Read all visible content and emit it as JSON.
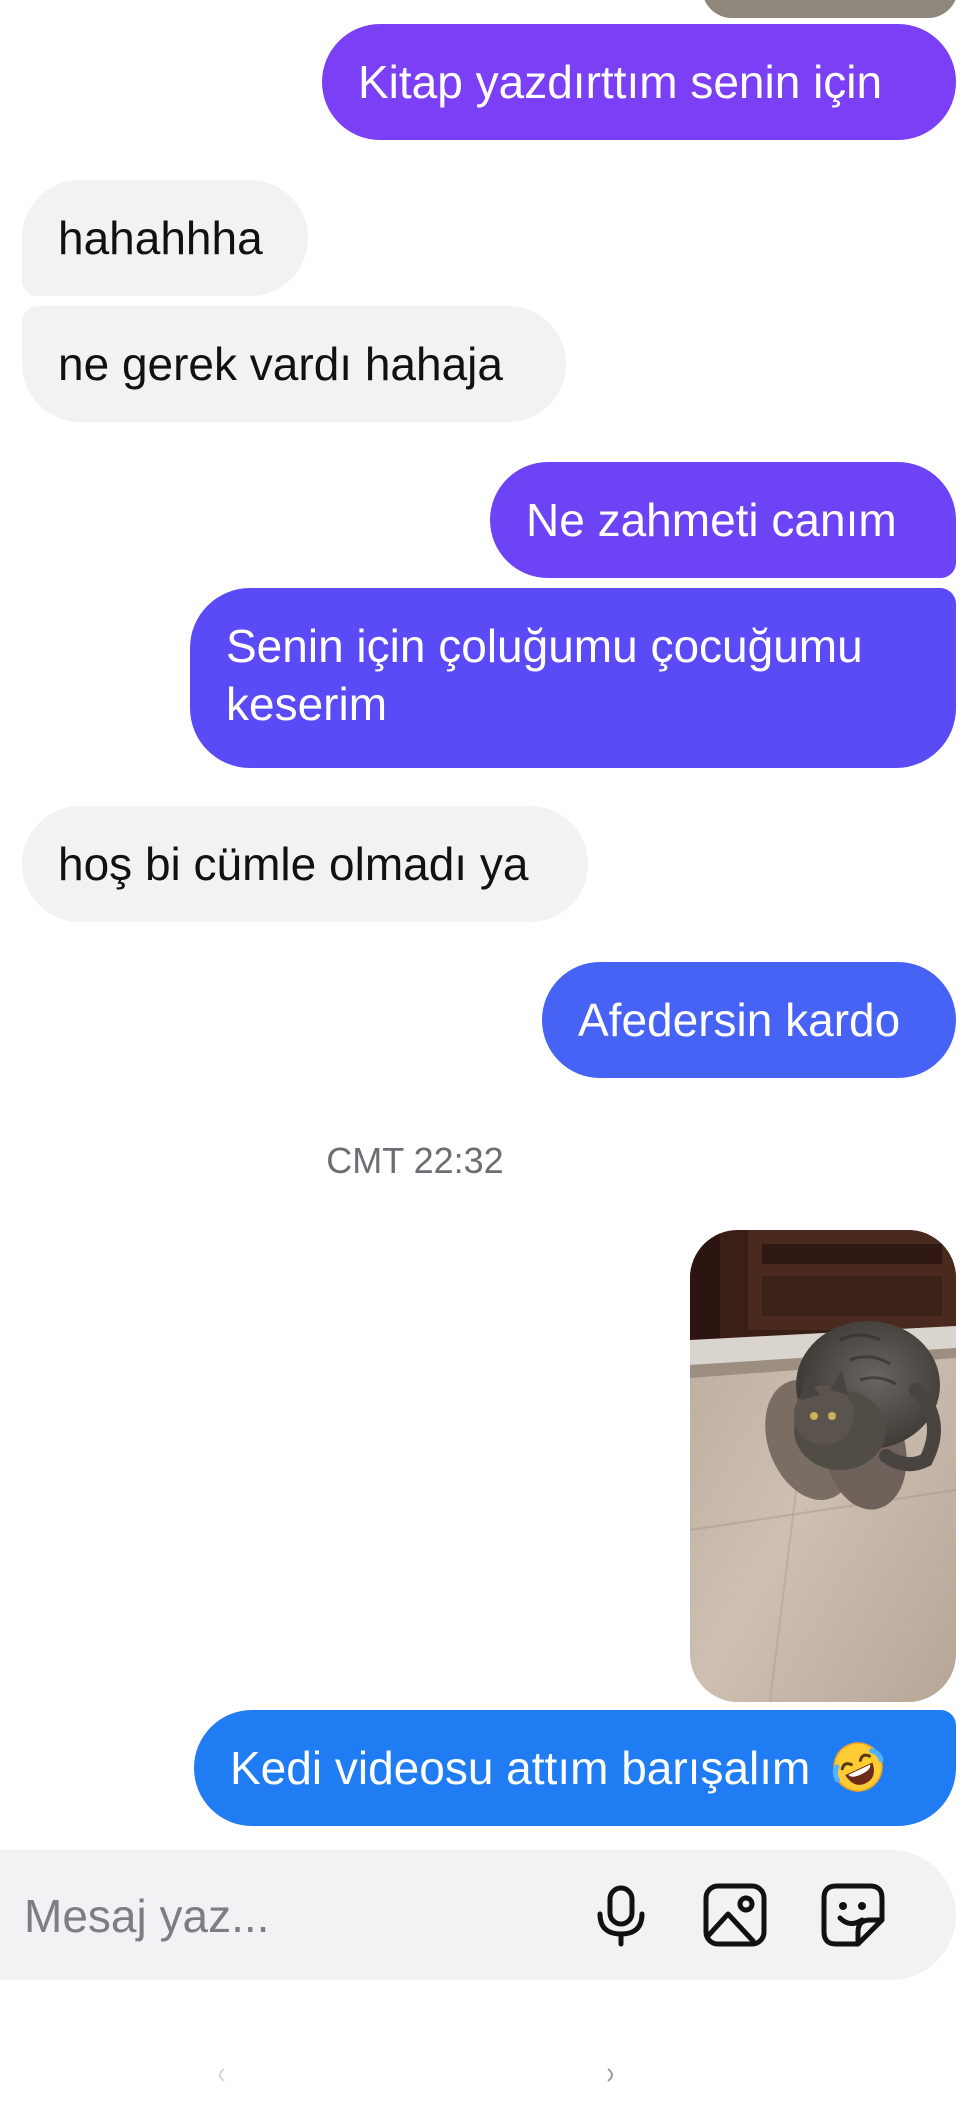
{
  "messages": [
    {
      "id": "m1",
      "direction": "outgoing",
      "text": "Kitap yazdırttım senin için",
      "color": "#7b3ff5"
    },
    {
      "id": "m2",
      "direction": "incoming",
      "text": "hahahhha"
    },
    {
      "id": "m3",
      "direction": "incoming",
      "text": "ne gerek vardı hahaja"
    },
    {
      "id": "m4",
      "direction": "outgoing",
      "text": "Ne zahmeti canım",
      "color": "#6c44f5"
    },
    {
      "id": "m5",
      "direction": "outgoing",
      "text": "Senin için çoluğumu çocuğumu",
      "text_line2": "keserim",
      "color": "#5b4bf6"
    },
    {
      "id": "m6",
      "direction": "incoming",
      "text": "hoş bi cümle olmadı ya"
    },
    {
      "id": "m7",
      "direction": "outgoing",
      "text": "Afedersin kardo",
      "color": "#4763f5"
    },
    {
      "id": "m8",
      "direction": "outgoing",
      "type": "video",
      "media_icon": "cat-video-thumbnail"
    },
    {
      "id": "m9",
      "direction": "outgoing",
      "text": "Kedi videosu attım barışalım",
      "emoji_icon": "rolling-on-floor-laughing-emoji",
      "color": "#1f7cf3"
    }
  ],
  "timestamp": "CMT 22:32",
  "composer": {
    "placeholder": "Mesaj yaz...",
    "icons": [
      "microphone-icon",
      "image-icon",
      "sticker-icon"
    ]
  },
  "colors": {
    "incoming_bubble": "#f1f2f4",
    "composer_bg": "#f1f2f4",
    "timestamp_text": "#6b6e73"
  }
}
